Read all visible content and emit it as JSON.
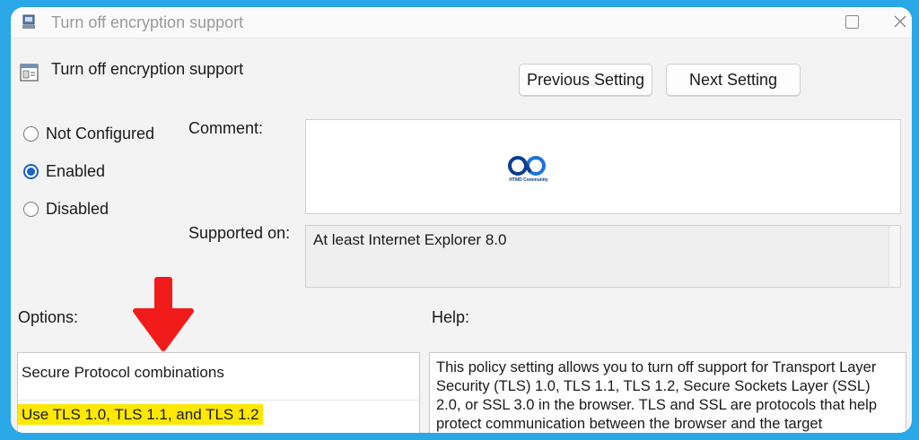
{
  "window": {
    "title": "Turn off encryption support"
  },
  "header": {
    "title": "Turn off encryption support",
    "previous_label": "Previous Setting",
    "next_label": "Next Setting"
  },
  "state": {
    "options": [
      "Not Configured",
      "Enabled",
      "Disabled"
    ],
    "selected": "Enabled"
  },
  "comment": {
    "label": "Comment:",
    "logo_caption": "HTMD Community"
  },
  "supported": {
    "label": "Supported on:",
    "value": "At least Internet Explorer 8.0"
  },
  "options": {
    "label": "Options:",
    "setting_name": "Secure Protocol combinations",
    "setting_value": "Use TLS 1.0, TLS 1.1, and TLS 1.2"
  },
  "help": {
    "label": "Help:",
    "text": "This policy setting allows you to turn off support for Transport Layer Security (TLS) 1.0, TLS 1.1, TLS 1.2, Secure Sockets Layer (SSL) 2.0, or SSL 3.0 in the browser. TLS and SSL are protocols that help protect communication between the browser and the target"
  },
  "colors": {
    "frame_border": "#2aa7e6",
    "highlight": "#ffe800",
    "annotation_arrow": "#f21b1b",
    "radio_selected": "#1a62c6"
  },
  "icons": [
    "policy-app-icon",
    "setting-icon",
    "maximize-icon",
    "close-icon",
    "down-arrow-icon"
  ]
}
